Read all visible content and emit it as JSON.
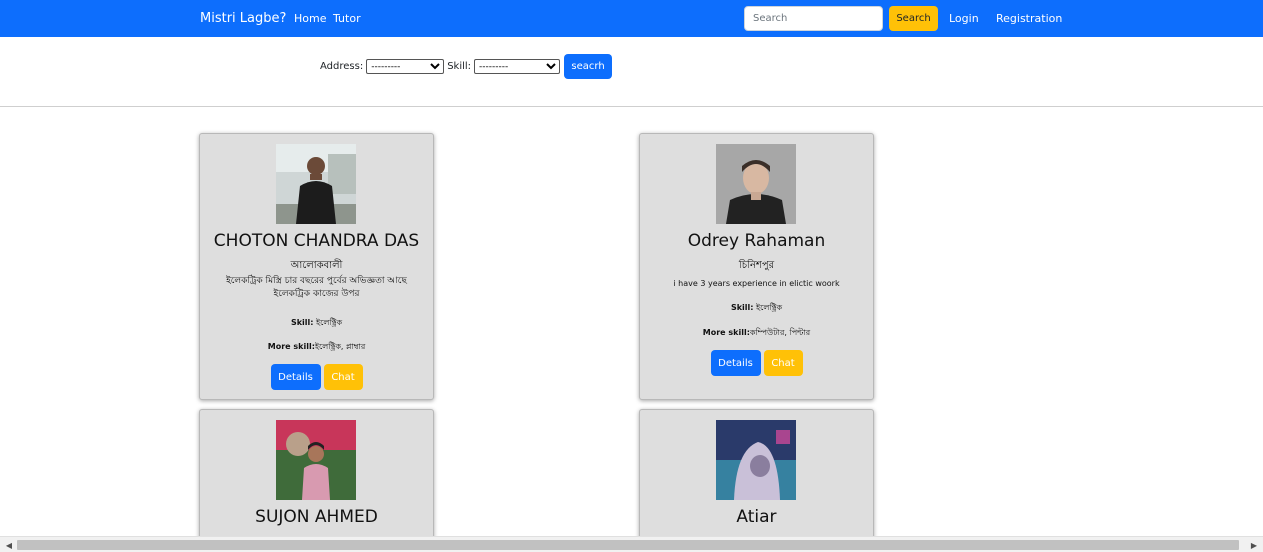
{
  "navbar": {
    "brand": "Mistri Lagbe?",
    "links": [
      "Home",
      "Tutor"
    ],
    "search_placeholder": "Search",
    "search_button": "Search",
    "login": "Login",
    "registration": "Registration",
    "bg_color": "#0d6efd"
  },
  "filter": {
    "address_label": "Address:",
    "address_value": "---------",
    "skill_label": "Skill:",
    "skill_value": "---------",
    "button": "seacrh"
  },
  "cards": [
    {
      "name": "CHOTON CHANDRA DAS",
      "address": "আলোকবালী",
      "description": "ইলেকট্রিক মিস্ত্রি চার বছরের পুর্বের অভিজ্ঞতা আছে ইলেকট্রিক কাজের উপর",
      "skill_label": "Skill:",
      "skill": "ইলেক্ট্রিক",
      "more_skill_label": "More skill:",
      "more_skill": "ইলেক্ট্রিক, প্লাম্বার",
      "details": "Details",
      "chat": "Chat"
    },
    {
      "name": "Odrey Rahaman",
      "address": "চিনিশপুর",
      "description": "i have 3 years experience in elictic woork",
      "skill_label": "Skill:",
      "skill": "ইলেক্ট্রিক",
      "more_skill_label": "More skill:",
      "more_skill": "কম্পিউটার, পিন্টার",
      "details": "Details",
      "chat": "Chat"
    },
    {
      "name": "SUJON AHMED"
    },
    {
      "name": "Atiar"
    }
  ],
  "colors": {
    "primary": "#0d6efd",
    "warning": "#ffc107",
    "card_bg": "#dedede"
  }
}
